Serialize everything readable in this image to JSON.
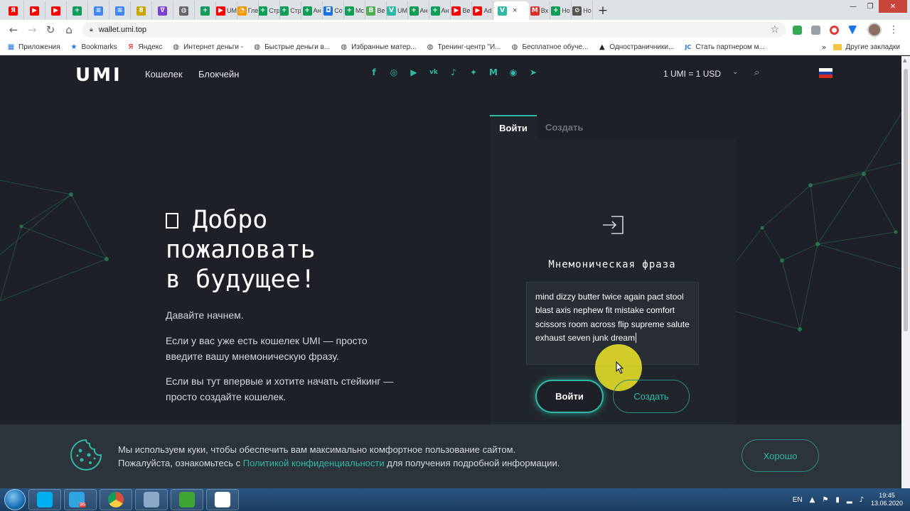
{
  "browser": {
    "tabs": [
      {
        "icon": "yandex-icon",
        "color": "#ff0000",
        "glyph": "Я",
        "title": ""
      },
      {
        "icon": "youtube-icon",
        "color": "#ff0000",
        "glyph": "▶",
        "title": ""
      },
      {
        "icon": "youtube-icon",
        "color": "#ff0000",
        "glyph": "▶",
        "title": ""
      },
      {
        "icon": "sheets-icon",
        "color": "#0f9d58",
        "glyph": "+",
        "title": ""
      },
      {
        "icon": "docs-icon",
        "color": "#4285f4",
        "glyph": "≡",
        "title": ""
      },
      {
        "icon": "docs-icon",
        "color": "#4285f4",
        "glyph": "≡",
        "title": ""
      },
      {
        "icon": "game-icon",
        "color": "#c9a600",
        "glyph": "8",
        "title": ""
      },
      {
        "icon": "vk-icon",
        "color": "#7b3fd1",
        "glyph": "∇",
        "title": ""
      },
      {
        "icon": "globe-icon",
        "color": "#666666",
        "glyph": "◍",
        "title": ""
      },
      {
        "icon": "sheets-icon",
        "color": "#0f9d58",
        "glyph": "+",
        "title": ""
      },
      {
        "icon": "youtube-icon",
        "color": "#ff0000",
        "glyph": "▶",
        "title": "UM"
      },
      {
        "icon": "clock-icon",
        "color": "#f29900",
        "glyph": "◔",
        "title": "Гле"
      },
      {
        "icon": "sheets-icon",
        "color": "#0f9d58",
        "glyph": "+",
        "title": "Стр"
      },
      {
        "icon": "sheets-icon",
        "color": "#0f9d58",
        "glyph": "+",
        "title": "Стр"
      },
      {
        "icon": "sheets-icon",
        "color": "#0f9d58",
        "glyph": "+",
        "title": "Ан"
      },
      {
        "icon": "chat-icon",
        "color": "#1a73e8",
        "glyph": "◘",
        "title": "Со"
      },
      {
        "icon": "sheets-icon",
        "color": "#0f9d58",
        "glyph": "+",
        "title": "Мс"
      },
      {
        "icon": "book-icon",
        "color": "#4caf50",
        "glyph": "B",
        "title": "Ве"
      },
      {
        "icon": "umi-icon",
        "color": "#2fb8a6",
        "glyph": "V",
        "title": "UM"
      },
      {
        "icon": "sheets-icon",
        "color": "#0f9d58",
        "glyph": "+",
        "title": "Ан"
      },
      {
        "icon": "sheets-icon",
        "color": "#0f9d58",
        "glyph": "+",
        "title": "Ан"
      },
      {
        "icon": "youtube-icon",
        "color": "#ff0000",
        "glyph": "▶",
        "title": "Ве"
      },
      {
        "icon": "youtube-icon",
        "color": "#ff0000",
        "glyph": "▶",
        "title": "Ad"
      }
    ],
    "active_tab": {
      "icon": "umi-icon",
      "color": "#2fb8a6",
      "glyph": "V",
      "close": "×"
    },
    "tabs_after": [
      {
        "icon": "gmail-icon",
        "color": "#d93025",
        "glyph": "M",
        "title": "Вх"
      },
      {
        "icon": "sheets-icon",
        "color": "#0f9d58",
        "glyph": "+",
        "title": "Но"
      },
      {
        "icon": "globe-icon",
        "color": "#555555",
        "glyph": "⊘",
        "title": "Но"
      }
    ],
    "new_tab": "+",
    "url": "wallet.umi.top",
    "bookmarks": [
      {
        "icon": "apps-icon",
        "glyph": "▦",
        "label": "Приложения",
        "color": "#1a73e8"
      },
      {
        "icon": "star-icon",
        "glyph": "★",
        "label": "Bookmarks",
        "color": "#1a73e8"
      },
      {
        "icon": "yandex-icon",
        "glyph": "Я",
        "label": "Яндекс",
        "color": "#ff0000"
      },
      {
        "icon": "globe-icon",
        "glyph": "◍",
        "label": "Интернет деньги -",
        "color": "#444444"
      },
      {
        "icon": "globe-icon",
        "glyph": "◍",
        "label": "Быстрые деньги в...",
        "color": "#444444"
      },
      {
        "icon": "globe-icon",
        "glyph": "◍",
        "label": "Избранные матер...",
        "color": "#444444"
      },
      {
        "icon": "globe-icon",
        "glyph": "◍",
        "label": "Тренинг-центр \"И...",
        "color": "#444444"
      },
      {
        "icon": "globe-icon",
        "glyph": "◍",
        "label": "Бесплатное обуче...",
        "color": "#444444"
      },
      {
        "icon": "graduation-icon",
        "glyph": "▲",
        "label": "Одностраничники...",
        "color": "#222222"
      },
      {
        "icon": "jc-icon",
        "glyph": "JC",
        "label": "Стать партнером м...",
        "color": "#1a73e8"
      }
    ],
    "bookmarks_more": "»",
    "other_bookmarks": "Другие закладки"
  },
  "site": {
    "logo": "UMI",
    "nav": [
      "Кошелек",
      "Блокчейн"
    ],
    "socials": [
      {
        "icon": "facebook-icon",
        "glyph": "f"
      },
      {
        "icon": "instagram-icon",
        "glyph": "◎"
      },
      {
        "icon": "youtube-icon",
        "glyph": "▶"
      },
      {
        "icon": "vk-icon",
        "glyph": "vk"
      },
      {
        "icon": "tiktok-icon",
        "glyph": "♪"
      },
      {
        "icon": "twitter-icon",
        "glyph": "✦"
      },
      {
        "icon": "medium-icon",
        "glyph": "M"
      },
      {
        "icon": "bitcointalk-icon",
        "glyph": "◉"
      },
      {
        "icon": "telegram-icon",
        "glyph": "➤"
      }
    ],
    "rate": "1 UMI = 1 USD",
    "hero": {
      "title_lines": [
        "Добро",
        "пожаловать",
        "в будущее!"
      ],
      "p1": "Давайте начнем.",
      "p2": "Если у вас уже есть кошелек UMI — просто введите вашу мнемоническую фразу.",
      "p3": "Если вы тут впервые и хотите начать стейкинг — просто создайте кошелек."
    },
    "login": {
      "tab_login": "Войти",
      "tab_create": "Создать",
      "label": "Мнемоническая фраза",
      "mnemonic": "mind dizzy butter twice again pact stool blast axis nephew fit mistake comfort scissors room across flip supreme salute exhaust seven junk dream",
      "btn_login": "Войти",
      "btn_create": "Создать"
    },
    "cookie": {
      "line1": "Мы используем куки, чтобы обеспечить вам максимально комфортное пользование сайтом.",
      "line2_pre": "Пожалуйста, ознакомьтесь с ",
      "line2_link": "Политикой конфиденциальности",
      "line2_post": " для получения подробной информации.",
      "button": "Хорошо"
    }
  },
  "taskbar": {
    "items": [
      {
        "icon": "skype-icon",
        "color": "#00aff0"
      },
      {
        "icon": "telegram-icon",
        "color": "#2ca5e0"
      },
      {
        "icon": "chrome-icon",
        "color": "#dd4b39"
      },
      {
        "icon": "tool-icon",
        "color": "#8aa9c9"
      },
      {
        "icon": "camtasia-icon",
        "color": "#3fa535"
      },
      {
        "icon": "camtasia-editor-icon",
        "color": "#ffffff"
      }
    ],
    "badge": "86",
    "lang": "EN",
    "time": "19:45",
    "date": "13.06.2020"
  },
  "colors": {
    "accent": "#2fb8a6",
    "bg": "#1d2127",
    "panel": "#20252b"
  }
}
